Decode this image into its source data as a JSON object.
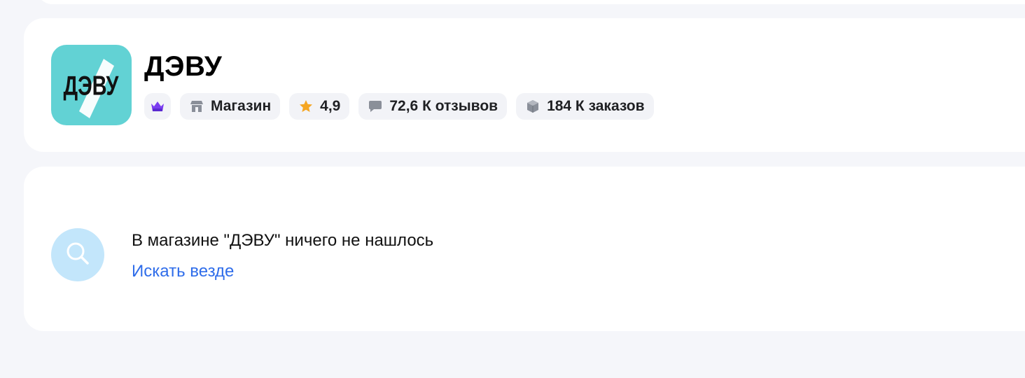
{
  "shop": {
    "logo_text": "ДЭВУ",
    "name": "ДЭВУ",
    "chips": {
      "type_label": "Магазин",
      "rating": "4,9",
      "reviews": "72,6 К отзывов",
      "orders": "184 К заказов"
    },
    "icons": {
      "premium": "crown-icon",
      "type": "store-icon",
      "rating": "star-icon",
      "reviews": "chat-bubble-icon",
      "orders": "box-icon"
    }
  },
  "empty_state": {
    "icon": "search-icon",
    "message": "В магазине \"ДЭВУ\" ничего не нашлось",
    "action_label": "Искать везде"
  },
  "colors": {
    "background": "#f5f6fa",
    "card": "#ffffff",
    "logo_bg": "#62d2d4",
    "accent_link": "#2f6dea",
    "crown": "#7b3df0",
    "star": "#f5a623",
    "search_badge": "#c3e6fb"
  }
}
